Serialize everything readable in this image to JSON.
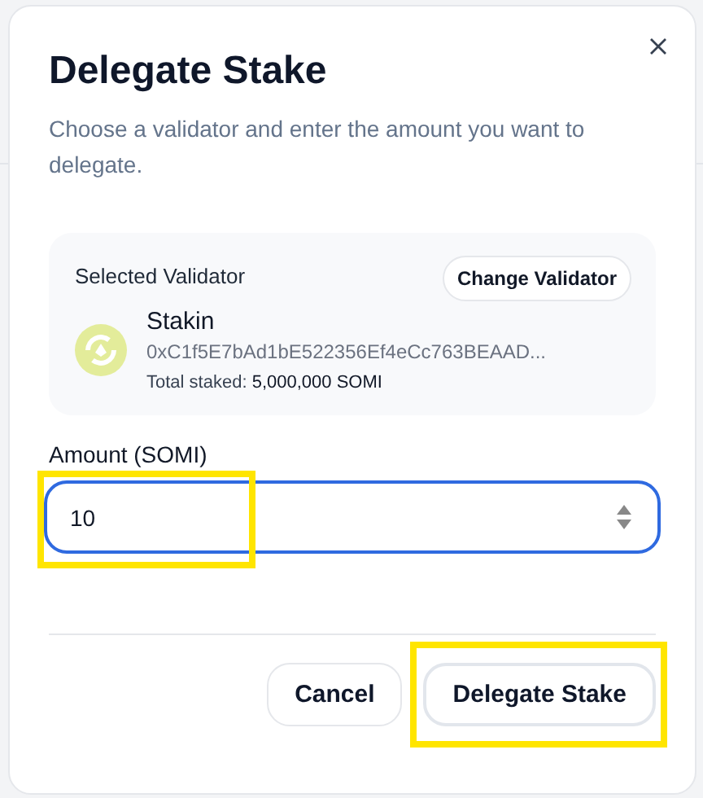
{
  "dialog": {
    "title": "Delegate Stake",
    "subtitle": "Choose a validator and enter the amount you want to delegate.",
    "validator": {
      "heading": "Selected Validator",
      "change_button": "Change Validator",
      "name": "Stakin",
      "address": "0xC1f5E7bAd1bE522356Ef4eCc763BEAAD...",
      "total": "Total staked: **5,000,000 SOMI**"
    },
    "amount": {
      "label": "Amount (SOMI)",
      "value": "10",
      "focused": true,
      "highlighted": true
    },
    "buttons": [
      {
        "label": "Cancel",
        "kind": "secondary"
      },
      {
        "label": "Delegate Stake",
        "kind": "primary",
        "highlighted": true
      }
    ]
  }
}
